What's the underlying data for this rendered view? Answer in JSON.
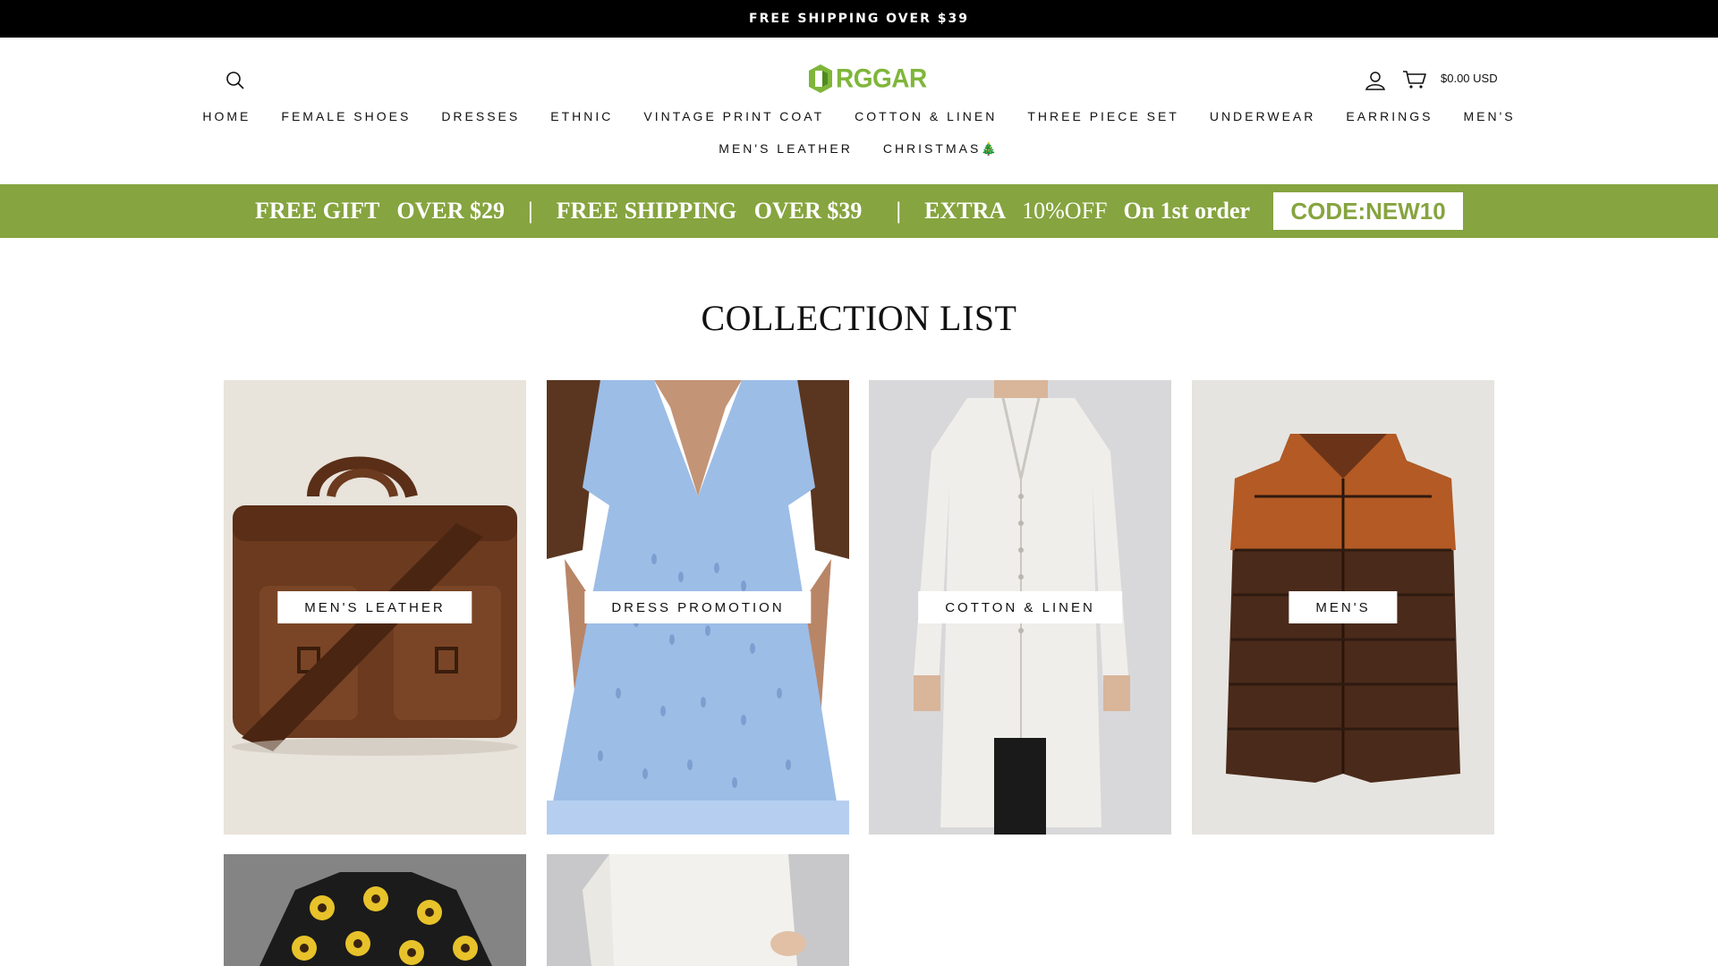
{
  "announcement": "FREE SHIPPING OVER $39",
  "header": {
    "logo_text": "RGGAR",
    "cart_total": "$0.00 USD",
    "icons": {
      "search": "search-icon",
      "account": "user-icon",
      "cart": "cart-icon"
    }
  },
  "nav": {
    "row1": [
      "HOME",
      "FEMALE SHOES",
      "DRESSES",
      "ETHNIC",
      "VINTAGE PRINT COAT",
      "COTTON & LINEN",
      "THREE PIECE SET",
      "UNDERWEAR",
      "EARRINGS",
      "MEN'S"
    ],
    "row2": [
      "MEN'S LEATHER",
      "CHRISTMAS🎄"
    ]
  },
  "promo": {
    "gift": "FREE GIFT   OVER $29",
    "shipping": "FREE SHIPPING   OVER $39",
    "extra": "EXTRA",
    "discount": "10%OFF",
    "order": "On 1st order",
    "code": "CODE:NEW10",
    "separator": "|",
    "bg_color": "#86a43f"
  },
  "section_title": "COLLECTION LIST",
  "collections": [
    {
      "label": "MEN'S LEATHER",
      "image": "leather-bag"
    },
    {
      "label": "DRESS PROMOTION",
      "image": "blue-dress"
    },
    {
      "label": "COTTON & LINEN",
      "image": "linen-coat"
    },
    {
      "label": "MEN'S",
      "image": "leather-vest"
    },
    {
      "label": "",
      "image": "sunflower-jacket"
    },
    {
      "label": "",
      "image": "white-blouse"
    }
  ]
}
